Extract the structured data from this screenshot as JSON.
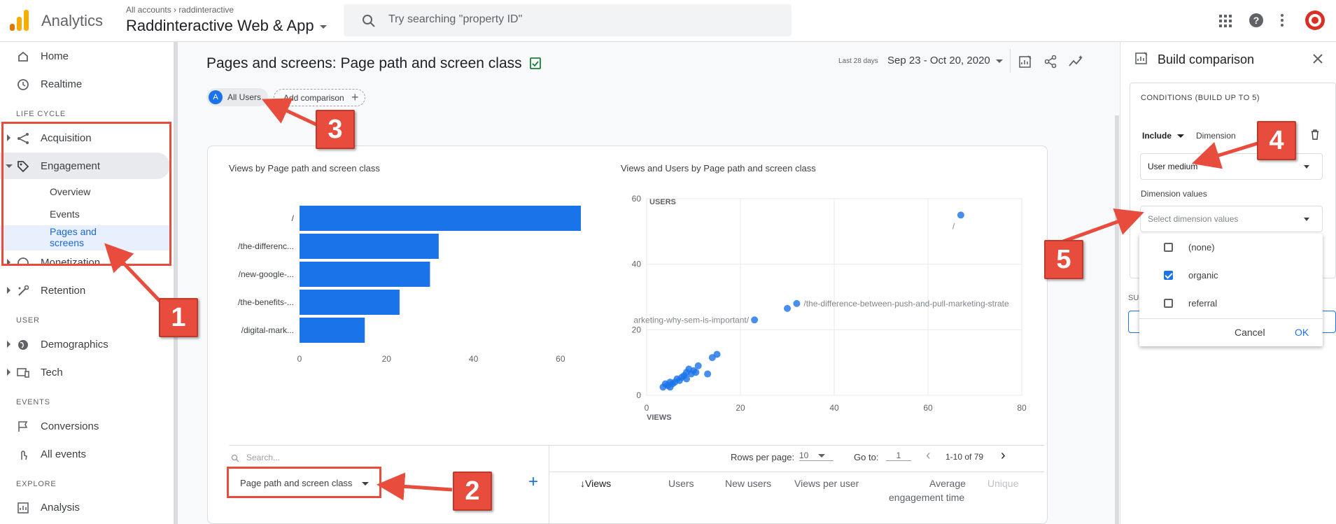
{
  "header": {
    "app_title": "Analytics",
    "account_crumb": "All accounts › raddinteractive",
    "property_name": "Raddinteractive Web & App",
    "search_placeholder": "Try searching \"property ID\""
  },
  "sidebar": {
    "home": "Home",
    "realtime": "Realtime",
    "section_lifecycle": "LIFE CYCLE",
    "acquisition": "Acquisition",
    "engagement": "Engagement",
    "engagement_children": [
      "Overview",
      "Events",
      "Pages and",
      "screens"
    ],
    "monetization": "Monetization",
    "retention": "Retention",
    "section_user": "USER",
    "demographics": "Demographics",
    "tech": "Tech",
    "section_events": "EVENTS",
    "conversions": "Conversions",
    "all_events": "All events",
    "section_explore": "EXPLORE",
    "analysis": "Analysis"
  },
  "report": {
    "title": "Pages and screens: Page path and screen class",
    "date_label": "Last 28 days",
    "date_range": "Sep 23 - Oct 20, 2020",
    "chip_avatar": "A",
    "chip_all_users": "All Users",
    "add_comparison": "Add comparison"
  },
  "bar_chart_title": "Views by Page path and screen class",
  "scatter_chart_title": "Views and Users by Page path and screen class",
  "chart_data": [
    {
      "type": "bar",
      "orientation": "horizontal",
      "title": "Views by Page path and screen class",
      "categories": [
        "/",
        "/the-differenc...",
        "/new-google-...",
        "/the-benefits-...",
        "/digital-mark..."
      ],
      "values": [
        67,
        32,
        30,
        23,
        15
      ],
      "xlim": [
        0,
        70
      ],
      "xticks": [
        0,
        20,
        40,
        60
      ],
      "color": "#1a73e8"
    },
    {
      "type": "scatter",
      "title": "Views and Users by Page path and screen class",
      "xlabel": "VIEWS",
      "ylabel": "USERS",
      "xlim": [
        0,
        80
      ],
      "ylim": [
        0,
        60
      ],
      "xticks": [
        0,
        20,
        40,
        60,
        80
      ],
      "yticks": [
        0,
        20,
        40,
        60
      ],
      "annotations": [
        {
          "text": "/",
          "x": 67,
          "y": 55
        },
        {
          "text": "/the-difference-between-push-and-pull-marketing-strate",
          "x": 32,
          "y": 28
        },
        {
          "text": "arketing-why-sem-is-important/",
          "x": 23,
          "y": 23
        }
      ],
      "points": [
        {
          "x": 67,
          "y": 55
        },
        {
          "x": 32,
          "y": 28
        },
        {
          "x": 30,
          "y": 26.5
        },
        {
          "x": 23,
          "y": 23
        },
        {
          "x": 15,
          "y": 12.5
        },
        {
          "x": 14,
          "y": 11.5
        },
        {
          "x": 13,
          "y": 6.5
        },
        {
          "x": 11,
          "y": 9
        },
        {
          "x": 10.5,
          "y": 7
        },
        {
          "x": 10,
          "y": 7.5
        },
        {
          "x": 9.5,
          "y": 6.5
        },
        {
          "x": 9,
          "y": 8
        },
        {
          "x": 8.5,
          "y": 7
        },
        {
          "x": 8.5,
          "y": 5
        },
        {
          "x": 8,
          "y": 6
        },
        {
          "x": 7.5,
          "y": 5.5
        },
        {
          "x": 7,
          "y": 4.5
        },
        {
          "x": 6.5,
          "y": 5
        },
        {
          "x": 6,
          "y": 4
        },
        {
          "x": 5.5,
          "y": 3.5
        },
        {
          "x": 5,
          "y": 4
        },
        {
          "x": 5,
          "y": 2.5
        },
        {
          "x": 4.5,
          "y": 3
        },
        {
          "x": 4,
          "y": 3.5
        },
        {
          "x": 3.5,
          "y": 2.5
        }
      ],
      "color": "#1a73e8"
    }
  ],
  "table": {
    "search_placeholder": "Search...",
    "rows_per_page_label": "Rows per page:",
    "rows_per_page": "10",
    "goto_label": "Go to:",
    "goto_value": "1",
    "page_range": "1-10 of 79",
    "dimension": "Page path and screen class",
    "columns": [
      "↓Views",
      "Users",
      "New users",
      "Views per user",
      "Average",
      "engagement time",
      "Unique"
    ]
  },
  "panel": {
    "title": "Build comparison",
    "conditions_title": "CONDITIONS (BUILD UP TO 5)",
    "include": "Include",
    "dimension_label": "Dimension",
    "dimension_value": "User medium",
    "dim_values_label": "Dimension values",
    "dim_values_placeholder": "Select dimension values",
    "options": [
      {
        "label": "(none)",
        "checked": false
      },
      {
        "label": "organic",
        "checked": true
      },
      {
        "label": "referral",
        "checked": false
      }
    ],
    "cancel": "Cancel",
    "ok": "OK",
    "partial_label": "SU"
  },
  "callouts": [
    "1",
    "2",
    "3",
    "4",
    "5"
  ],
  "colors": {
    "accent": "#1a73e8",
    "annotation_red": "#e74c3c",
    "logo_orange": "#f9ab00",
    "logo_dark_orange": "#e37400"
  }
}
